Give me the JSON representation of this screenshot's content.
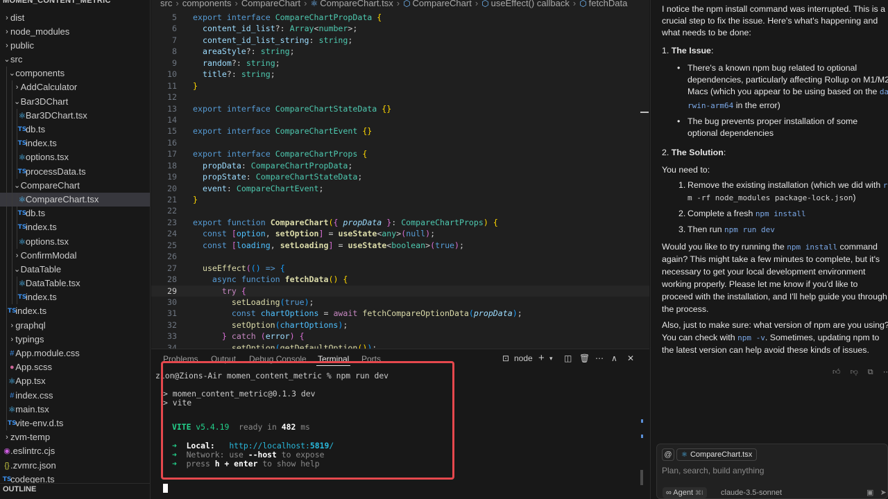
{
  "explorer": {
    "header": "MOMEN_CONTENT_METRIC",
    "outline": "OUTLINE",
    "items": [
      {
        "label": "dist",
        "depth": 0,
        "icon": "chevron-right",
        "name": "tree-folder-dist"
      },
      {
        "label": "node_modules",
        "depth": 0,
        "icon": "chevron-right",
        "name": "tree-folder-node-modules"
      },
      {
        "label": "public",
        "depth": 0,
        "icon": "chevron-right",
        "name": "tree-folder-public"
      },
      {
        "label": "src",
        "depth": 0,
        "icon": "chevron-down",
        "name": "tree-folder-src"
      },
      {
        "label": "components",
        "depth": 1,
        "icon": "chevron-down",
        "name": "tree-folder-components"
      },
      {
        "label": "AddCalculator",
        "depth": 2,
        "icon": "chevron-right",
        "name": "tree-folder-addcalculator"
      },
      {
        "label": "Bar3DChart",
        "depth": 2,
        "icon": "chevron-down",
        "name": "tree-folder-bar3dchart"
      },
      {
        "label": "Bar3DChart.tsx",
        "depth": 3,
        "icon": "tsx",
        "name": "tree-file-bar3dchart-tsx"
      },
      {
        "label": "db.ts",
        "depth": 3,
        "icon": "ts",
        "name": "tree-file-db-ts"
      },
      {
        "label": "index.ts",
        "depth": 3,
        "icon": "ts",
        "name": "tree-file-index-ts"
      },
      {
        "label": "options.tsx",
        "depth": 3,
        "icon": "tsx",
        "name": "tree-file-options-tsx"
      },
      {
        "label": "processData.ts",
        "depth": 3,
        "icon": "ts",
        "name": "tree-file-processdata-ts"
      },
      {
        "label": "CompareChart",
        "depth": 2,
        "icon": "chevron-down",
        "name": "tree-folder-comparechart"
      },
      {
        "label": "CompareChart.tsx",
        "depth": 3,
        "icon": "tsx",
        "name": "tree-file-comparechart-tsx",
        "selected": true
      },
      {
        "label": "db.ts",
        "depth": 3,
        "icon": "ts",
        "name": "tree-file-db-ts-2"
      },
      {
        "label": "index.ts",
        "depth": 3,
        "icon": "ts",
        "name": "tree-file-index-ts-2"
      },
      {
        "label": "options.tsx",
        "depth": 3,
        "icon": "tsx",
        "name": "tree-file-options-tsx-2"
      },
      {
        "label": "ConfirmModal",
        "depth": 2,
        "icon": "chevron-right",
        "name": "tree-folder-confirmmodal"
      },
      {
        "label": "DataTable",
        "depth": 2,
        "icon": "chevron-down",
        "name": "tree-folder-datatable"
      },
      {
        "label": "DataTable.tsx",
        "depth": 3,
        "icon": "tsx",
        "name": "tree-file-datatable-tsx"
      },
      {
        "label": "index.ts",
        "depth": 3,
        "icon": "ts",
        "name": "tree-file-index-ts-3"
      },
      {
        "label": "index.ts",
        "depth": 1,
        "icon": "ts",
        "name": "tree-file-components-index-ts"
      },
      {
        "label": "graphql",
        "depth": 1,
        "icon": "chevron-right",
        "name": "tree-folder-graphql"
      },
      {
        "label": "typings",
        "depth": 1,
        "icon": "chevron-right",
        "name": "tree-folder-typings"
      },
      {
        "label": "App.module.css",
        "depth": 1,
        "icon": "css",
        "name": "tree-file-app-module-css"
      },
      {
        "label": "App.scss",
        "depth": 1,
        "icon": "scss",
        "name": "tree-file-app-scss"
      },
      {
        "label": "App.tsx",
        "depth": 1,
        "icon": "tsx",
        "name": "tree-file-app-tsx"
      },
      {
        "label": "index.css",
        "depth": 1,
        "icon": "css",
        "name": "tree-file-index-css"
      },
      {
        "label": "main.tsx",
        "depth": 1,
        "icon": "tsx",
        "name": "tree-file-main-tsx"
      },
      {
        "label": "vite-env.d.ts",
        "depth": 1,
        "icon": "ts",
        "name": "tree-file-vite-env-d-ts"
      },
      {
        "label": "zvm-temp",
        "depth": 0,
        "icon": "chevron-right",
        "name": "tree-folder-zvm-temp"
      },
      {
        "label": ".eslintrc.cjs",
        "depth": 0,
        "icon": "cjs",
        "name": "tree-file-eslintrc-cjs"
      },
      {
        "label": ".zvmrc.json",
        "depth": 0,
        "icon": "json",
        "name": "tree-file-zvmrc-json"
      },
      {
        "label": "codegen.ts",
        "depth": 0,
        "icon": "ts",
        "name": "tree-file-codegen-ts"
      }
    ]
  },
  "breadcrumb": {
    "parts": [
      "src",
      "components",
      "CompareChart",
      "CompareChart.tsx",
      "CompareChart",
      "useEffect() callback",
      "fetchData"
    ]
  },
  "editor": {
    "current_line": 29,
    "lines": [
      {
        "n": 5,
        "t": [
          [
            "kw",
            "export "
          ],
          [
            "kw",
            "interface "
          ],
          [
            "ty",
            "CompareChartPropData "
          ],
          [
            "br1",
            "{"
          ]
        ]
      },
      {
        "n": 6,
        "t": [
          [
            "",
            "  "
          ],
          [
            "vr",
            "content_id_list"
          ],
          [
            "",
            "?: "
          ],
          [
            "ty",
            "Array"
          ],
          [
            "",
            "<"
          ],
          [
            "ty",
            "number"
          ],
          [
            "",
            ">;"
          ]
        ]
      },
      {
        "n": 7,
        "t": [
          [
            "",
            "  "
          ],
          [
            "vr",
            "content_id_list_string"
          ],
          [
            "",
            ": "
          ],
          [
            "ty",
            "string"
          ],
          [
            "",
            ";"
          ]
        ]
      },
      {
        "n": 8,
        "t": [
          [
            "",
            "  "
          ],
          [
            "vr",
            "areaStyle"
          ],
          [
            "",
            "?: "
          ],
          [
            "ty",
            "string"
          ],
          [
            "",
            ";"
          ]
        ]
      },
      {
        "n": 9,
        "t": [
          [
            "",
            "  "
          ],
          [
            "vr",
            "random"
          ],
          [
            "",
            "?: "
          ],
          [
            "ty",
            "string"
          ],
          [
            "",
            ";"
          ]
        ]
      },
      {
        "n": 10,
        "t": [
          [
            "",
            "  "
          ],
          [
            "vr",
            "title"
          ],
          [
            "",
            "?: "
          ],
          [
            "ty",
            "string"
          ],
          [
            "",
            ";"
          ]
        ]
      },
      {
        "n": 11,
        "t": [
          [
            "br1",
            "}"
          ]
        ]
      },
      {
        "n": 12,
        "t": []
      },
      {
        "n": 13,
        "t": [
          [
            "kw",
            "export "
          ],
          [
            "kw",
            "interface "
          ],
          [
            "ty",
            "CompareChartStateData "
          ],
          [
            "br1",
            "{}"
          ]
        ]
      },
      {
        "n": 14,
        "t": []
      },
      {
        "n": 15,
        "t": [
          [
            "kw",
            "export "
          ],
          [
            "kw",
            "interface "
          ],
          [
            "ty",
            "CompareChartEvent "
          ],
          [
            "br1",
            "{}"
          ]
        ]
      },
      {
        "n": 16,
        "t": []
      },
      {
        "n": 17,
        "t": [
          [
            "kw",
            "export "
          ],
          [
            "kw",
            "interface "
          ],
          [
            "ty",
            "CompareChartProps "
          ],
          [
            "br1",
            "{"
          ]
        ]
      },
      {
        "n": 18,
        "t": [
          [
            "",
            "  "
          ],
          [
            "vr",
            "propData"
          ],
          [
            "",
            ": "
          ],
          [
            "ty",
            "CompareChartPropData"
          ],
          [
            "",
            ";"
          ]
        ]
      },
      {
        "n": 19,
        "t": [
          [
            "",
            "  "
          ],
          [
            "vr",
            "propState"
          ],
          [
            "",
            ": "
          ],
          [
            "ty",
            "CompareChartStateData"
          ],
          [
            "",
            ";"
          ]
        ]
      },
      {
        "n": 20,
        "t": [
          [
            "",
            "  "
          ],
          [
            "vr",
            "event"
          ],
          [
            "",
            ": "
          ],
          [
            "ty",
            "CompareChartEvent"
          ],
          [
            "",
            ";"
          ]
        ]
      },
      {
        "n": 21,
        "t": [
          [
            "br1",
            "}"
          ]
        ]
      },
      {
        "n": 22,
        "t": []
      },
      {
        "n": 23,
        "t": [
          [
            "kw",
            "export "
          ],
          [
            "kw",
            "function "
          ],
          [
            "fn",
            "CompareChart"
          ],
          [
            "br1",
            "("
          ],
          [
            "br2",
            "{ "
          ],
          [
            "pr",
            "propData "
          ],
          [
            "br2",
            "}"
          ],
          [
            "",
            ": "
          ],
          [
            "ty",
            "CompareChartProps"
          ],
          [
            "br1",
            ") "
          ],
          [
            "br1",
            "{"
          ]
        ]
      },
      {
        "n": 24,
        "t": [
          [
            "",
            "  "
          ],
          [
            "kw",
            "const "
          ],
          [
            "br2",
            "["
          ],
          [
            "ct",
            "option"
          ],
          [
            "",
            ", "
          ],
          [
            "fn",
            "setOption"
          ],
          [
            "br2",
            "]"
          ],
          [
            "",
            " = "
          ],
          [
            "fn",
            "useState"
          ],
          [
            "",
            "<"
          ],
          [
            "ty",
            "any"
          ],
          [
            "",
            ">"
          ],
          [
            "br2",
            "("
          ],
          [
            "bo",
            "null"
          ],
          [
            "br2",
            ")"
          ],
          [
            "",
            ";"
          ]
        ]
      },
      {
        "n": 25,
        "t": [
          [
            "",
            "  "
          ],
          [
            "kw",
            "const "
          ],
          [
            "br2",
            "["
          ],
          [
            "ct",
            "loading"
          ],
          [
            "",
            ", "
          ],
          [
            "fn",
            "setLoading"
          ],
          [
            "br2",
            "]"
          ],
          [
            "",
            " = "
          ],
          [
            "fn",
            "useState"
          ],
          [
            "",
            "<"
          ],
          [
            "ty",
            "boolean"
          ],
          [
            "",
            ">"
          ],
          [
            "br2",
            "("
          ],
          [
            "bo",
            "true"
          ],
          [
            "br2",
            ")"
          ],
          [
            "",
            ";"
          ]
        ]
      },
      {
        "n": 26,
        "t": []
      },
      {
        "n": 27,
        "t": [
          [
            "",
            "  "
          ],
          [
            "tyb",
            "useEffect"
          ],
          [
            "br2",
            "("
          ],
          [
            "br3",
            "() "
          ],
          [
            "kw",
            "=> "
          ],
          [
            "br3",
            "{"
          ]
        ]
      },
      {
        "n": 28,
        "t": [
          [
            "",
            "    "
          ],
          [
            "kw",
            "async "
          ],
          [
            "kw",
            "function "
          ],
          [
            "fn",
            "fetchData"
          ],
          [
            "br1",
            "() "
          ],
          [
            "br1",
            "{"
          ]
        ]
      },
      {
        "n": 29,
        "t": [
          [
            "",
            "      "
          ],
          [
            "kc",
            "try "
          ],
          [
            "br2",
            "{"
          ]
        ]
      },
      {
        "n": 30,
        "t": [
          [
            "",
            "        "
          ],
          [
            "tyb",
            "setLoading"
          ],
          [
            "br3",
            "("
          ],
          [
            "bo",
            "true"
          ],
          [
            "br3",
            ")"
          ],
          [
            "",
            ";"
          ]
        ]
      },
      {
        "n": 31,
        "t": [
          [
            "",
            "        "
          ],
          [
            "kw",
            "const "
          ],
          [
            "ct",
            "chartOptions"
          ],
          [
            "",
            " = "
          ],
          [
            "kc",
            "await "
          ],
          [
            "tyb",
            "fetchCompareOptionData"
          ],
          [
            "br3",
            "("
          ],
          [
            "pr",
            "propData"
          ],
          [
            "br3",
            ")"
          ],
          [
            "",
            ";"
          ]
        ]
      },
      {
        "n": 32,
        "t": [
          [
            "",
            "        "
          ],
          [
            "tyb",
            "setOption"
          ],
          [
            "br3",
            "("
          ],
          [
            "ct",
            "chartOptions"
          ],
          [
            "br3",
            ")"
          ],
          [
            "",
            ";"
          ]
        ]
      },
      {
        "n": 33,
        "t": [
          [
            "",
            "      "
          ],
          [
            "br2",
            "} "
          ],
          [
            "kc",
            "catch "
          ],
          [
            "br2",
            "("
          ],
          [
            "vr",
            "error"
          ],
          [
            "br2",
            ") "
          ],
          [
            "br2",
            "{"
          ]
        ]
      },
      {
        "n": 34,
        "t": [
          [
            "",
            "        "
          ],
          [
            "tyb",
            "setOption"
          ],
          [
            "br3",
            "("
          ],
          [
            "tyb",
            "getDefaultOption"
          ],
          [
            "br1",
            "()"
          ],
          [
            "br3",
            ")"
          ],
          [
            "",
            ";"
          ]
        ]
      }
    ]
  },
  "panel": {
    "tabs": [
      "Problems",
      "Output",
      "Debug Console",
      "Terminal",
      "Ports"
    ],
    "active_tab": "Terminal",
    "terminal_name": "node",
    "lines": {
      "prompt": "zion@Zions-Air momen_content_metric % npm run dev",
      "script_line": "> momen_content_metric@0.1.3 dev",
      "vite_line": "> vite",
      "vite_name": "VITE",
      "vite_version": "v5.4.19",
      "ready_in": "ready in",
      "ready_ms": "482",
      "ms_unit": "ms",
      "local_label": "Local:",
      "local_url_prefix": "http://localhost:",
      "local_port": "5819",
      "local_url_suffix": "/",
      "network_label": "Network:",
      "network_use": "use",
      "network_flag": "--host",
      "network_rest": "to expose",
      "help_press": "press",
      "help_keys": "h + enter",
      "help_rest": "to show help",
      "arrow": "➜"
    }
  },
  "chat": {
    "intro": [
      "I notice the npm install command was interrupted. This is a",
      "crucial step to fix the issue. Here's what's happening and",
      "what needs to be done:"
    ],
    "issue_heading_num": "1.",
    "issue_heading": "The Issue",
    "issue_colon": ":",
    "b1": [
      "There's a known npm bug related to optional",
      "dependencies, particularly affecting Rollup on M1/M2",
      "Macs (which you appear to be using based on the"
    ],
    "b1_code_a": "da",
    "b1_code_b": "rwin-arm64",
    "b1_tail": "in the error)",
    "b2": [
      "The bug prevents proper installation of some",
      "optional dependencies"
    ],
    "solution_num": "2.",
    "solution_heading": "The Solution",
    "solution_colon": ":",
    "need": "You need to:",
    "s1_a": "Remove the existing installation (which we did with",
    "s1_code_a": "r",
    "s1_code_b": "m -rf node_modules package-lock.json",
    "s1_end": ")",
    "s2_a": "Complete a fresh",
    "s2_code": "npm install",
    "s3_a": "Then run",
    "s3_code": "npm run dev",
    "p1_a": "Would you like to try running the",
    "p1_code": "npm install",
    "p1_b": "command",
    "p1_rest": [
      "again? This might take a few minutes to complete, but it's",
      "necessary to get your local development environment",
      "working properly. Please let me know if you'd like to",
      "proceed with the installation, and I'll help guide you through",
      "the process."
    ],
    "p2_a": "Also, just to make sure: what version of npm are you using?",
    "p2_b": "You can check with",
    "p2_code": "npm -v",
    "p2_c": ". Sometimes, updating npm to",
    "p2_d": "the latest version can help avoid these kinds of issues."
  },
  "composer": {
    "at": "@",
    "context_file": "CompareChart.tsx",
    "placeholder": "Plan, search, build anything",
    "mode": "Agent",
    "mode_key": "⌘I",
    "model": "claude-3.5-sonnet"
  }
}
